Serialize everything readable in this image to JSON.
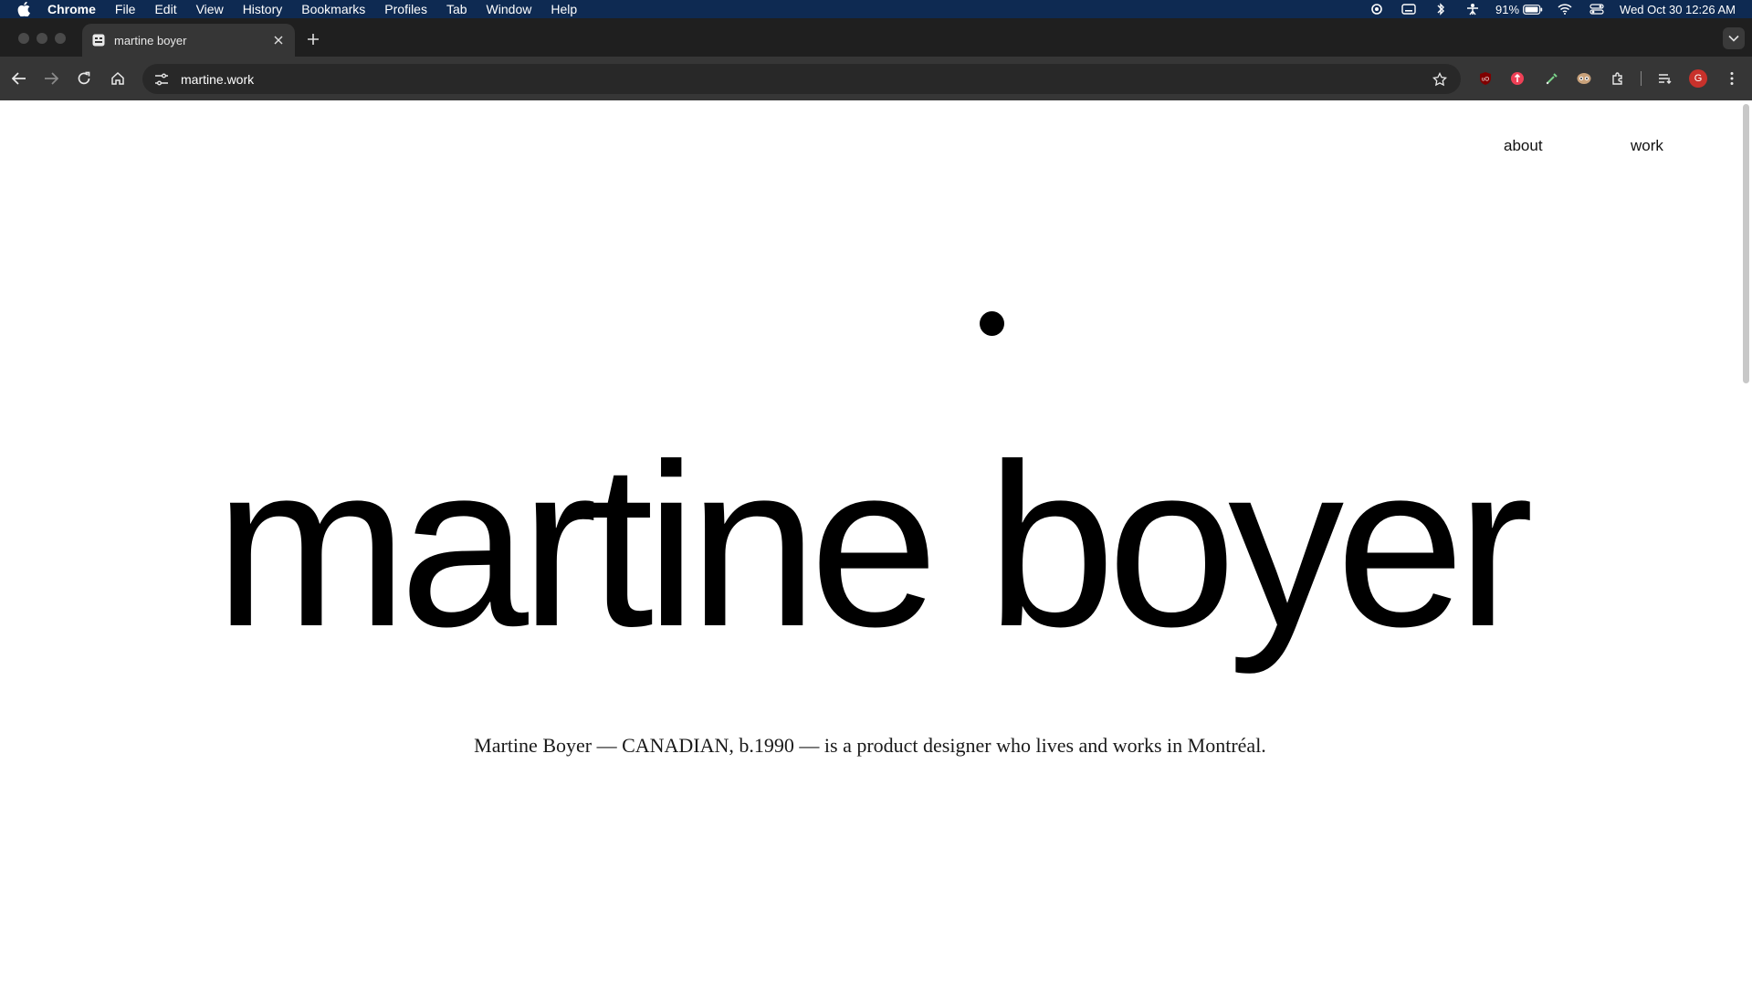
{
  "menubar": {
    "app_name": "Chrome",
    "items": [
      "File",
      "Edit",
      "View",
      "History",
      "Bookmarks",
      "Profiles",
      "Tab",
      "Window",
      "Help"
    ],
    "battery": "91%",
    "datetime": "Wed Oct 30  12:26 AM"
  },
  "tab": {
    "title": "martine boyer"
  },
  "toolbar": {
    "url": "martine.work",
    "avatar_letter": "G"
  },
  "page": {
    "nav": {
      "about": "about",
      "work": "work"
    },
    "hero_title": "martine boyer",
    "tagline": "Martine Boyer — CANADIAN, b.1990 — is a product designer who lives and works in Montréal."
  },
  "colors": {
    "menubar_bg": "#0e2a52",
    "tabstrip_bg": "#1f1f1f",
    "toolbar_bg": "#363636",
    "page_bg": "#ffffff",
    "text": "#000000"
  },
  "icons": {
    "menubar_right": [
      "screen-record-icon",
      "keyboard-icon",
      "bluetooth-icon",
      "accessibility-icon",
      "battery-icon",
      "wifi-icon",
      "control-center-icon"
    ],
    "extensions": [
      "ublock-icon",
      "pocket-icon",
      "eyedropper-icon",
      "ghostery-icon",
      "extensions-puzzle-icon",
      "reading-list-icon"
    ]
  }
}
